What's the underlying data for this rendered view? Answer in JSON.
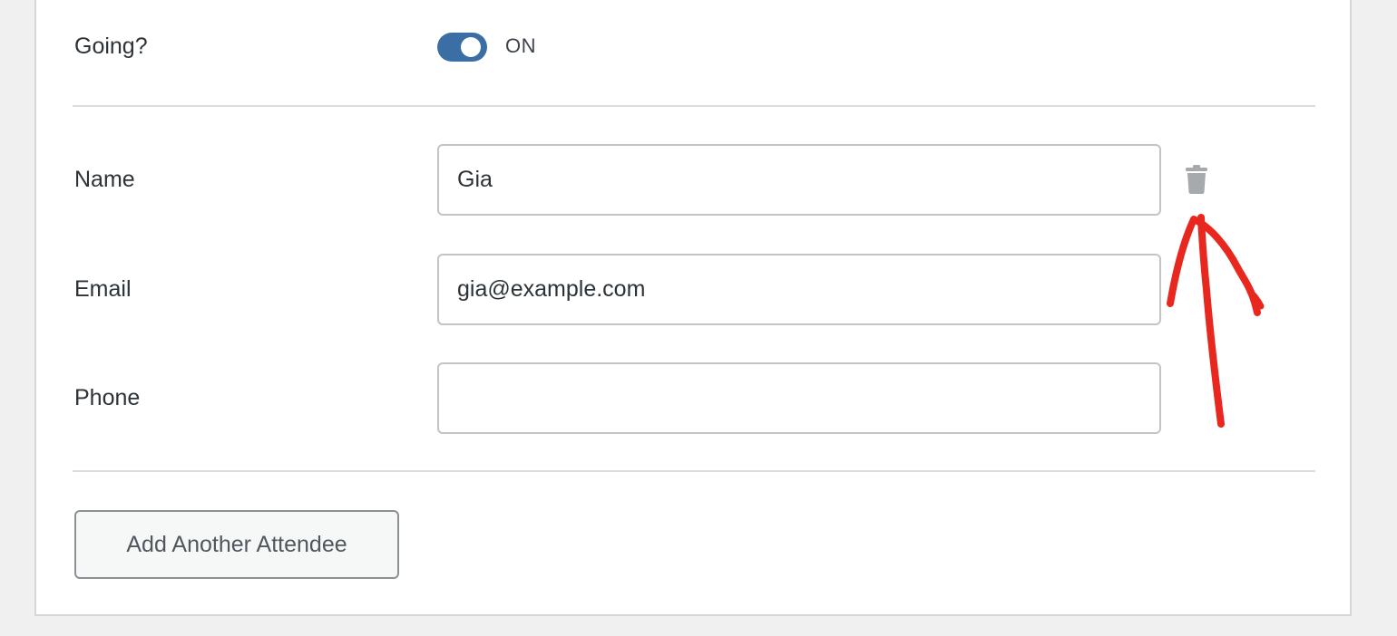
{
  "going": {
    "label": "Going?",
    "toggle_state": "ON",
    "toggle_on": true
  },
  "attendee": {
    "name_label": "Name",
    "name_value": "Gia",
    "email_label": "Email",
    "email_value": "gia@example.com",
    "phone_label": "Phone",
    "phone_value": ""
  },
  "actions": {
    "add_label": "Add Another Attendee",
    "delete_icon": "trash-icon"
  },
  "colors": {
    "toggle_on": "#3b6ea5",
    "annotation_arrow": "#e8281e",
    "trash_icon": "#a7aaad"
  }
}
